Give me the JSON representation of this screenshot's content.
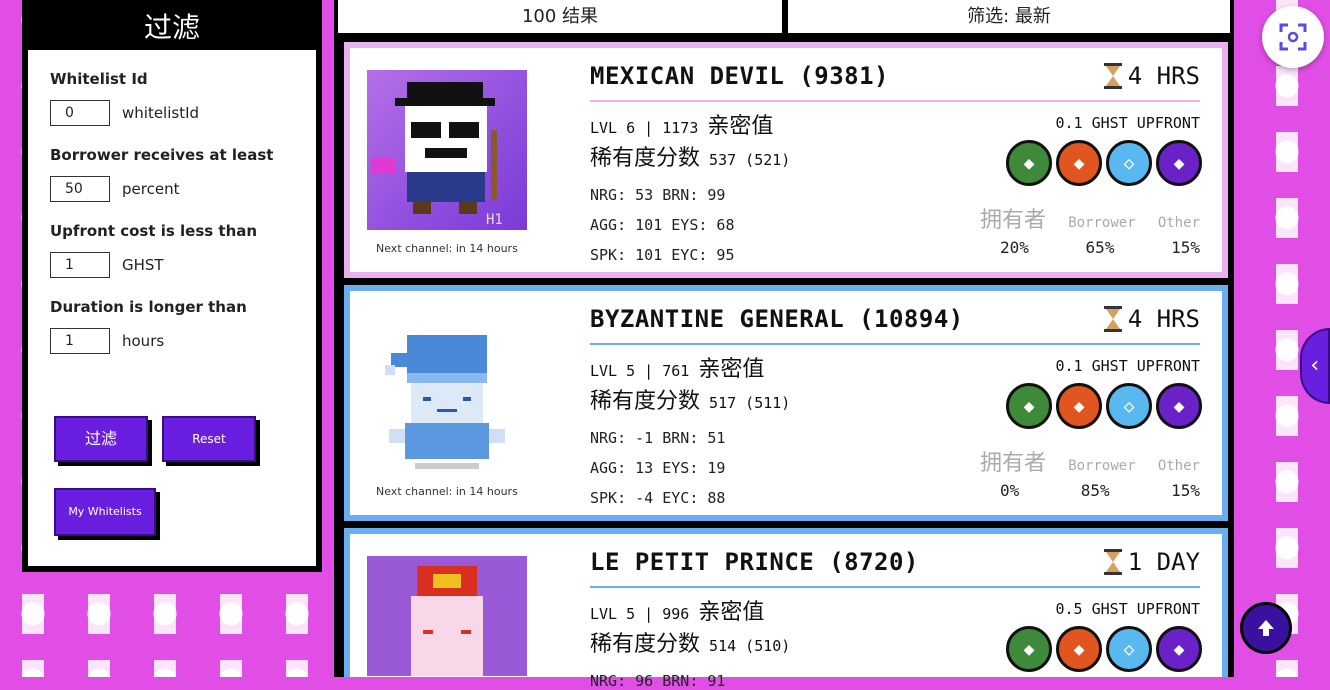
{
  "filter": {
    "title": "过滤",
    "whitelist_label": "Whitelist Id",
    "whitelist_value": "0",
    "whitelist_unit": "whitelistId",
    "borrower_label": "Borrower receives at least",
    "borrower_value": "50",
    "borrower_unit": "percent",
    "upfront_label": "Upfront cost is less than",
    "upfront_value": "1",
    "upfront_unit": "GHST",
    "duration_label": "Duration is longer than",
    "duration_value": "1",
    "duration_unit": "hours",
    "apply_label": "过滤",
    "reset_label": "Reset",
    "my_whitelists_label": "My Whitelists"
  },
  "header": {
    "results": "100 结果",
    "sort": "筛选: 最新"
  },
  "labels": {
    "next_channel": "Next channel: in 14 hours",
    "kinship": "亲密值",
    "rarity": "稀有度分数",
    "owner": "拥有者",
    "borrower": "Borrower",
    "other": "Other"
  },
  "cards": [
    {
      "name": "MEXICAN DEVIL (9381)",
      "time": "4 HRS",
      "level": "LVL 6 | 1173",
      "rarity_score": "537 (521)",
      "upfront": "0.1 GHST UPFRONT",
      "stats": [
        "NRG: 53 BRN: 99",
        "AGG: 101 EYS: 68",
        "SPK: 101 EYC: 95"
      ],
      "shares": [
        "20%",
        "65%",
        "15%"
      ],
      "badge": "H1"
    },
    {
      "name": "BYZANTINE GENERAL (10894)",
      "time": "4 HRS",
      "level": "LVL 5 | 761",
      "rarity_score": "517 (511)",
      "upfront": "0.1 GHST UPFRONT",
      "stats": [
        "NRG: -1  BRN: 51",
        "AGG: 13  EYS: 19",
        "SPK: -4  EYC: 88"
      ],
      "shares": [
        "0%",
        "85%",
        "15%"
      ]
    },
    {
      "name": "LE PETIT PRINCE (8720)",
      "time": "1 DAY",
      "level": "LVL 5 | 996",
      "rarity_score": "514 (510)",
      "upfront": "0.5 GHST UPFRONT",
      "stats": [
        "NRG: 96 BRN: 91"
      ]
    }
  ],
  "colors": {
    "accent": "#6a1ee0",
    "background": "#e04ee6",
    "card1_border": "#e8b0ef",
    "card2_border": "#6aaef2",
    "coin_green": "#3f8a3a",
    "coin_orange": "#e0561e",
    "coin_blue": "#5ab8f0",
    "coin_purple": "#6a22c8"
  },
  "icons": {
    "hourglass": "hourglass-icon",
    "scan": "scan-icon",
    "collapse": "chevron-left-icon",
    "scroll_top": "arrow-up-icon"
  }
}
